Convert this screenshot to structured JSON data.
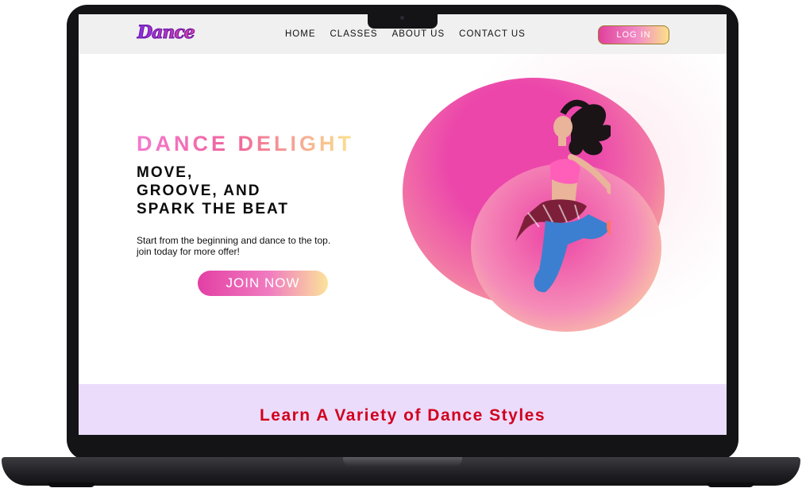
{
  "brand": {
    "logo_text": "Dance"
  },
  "nav": {
    "links": [
      {
        "label": "HOME"
      },
      {
        "label": "CLASSES"
      },
      {
        "label": "ABOUT US"
      },
      {
        "label": "CONTACT US"
      }
    ],
    "login_label": "LOG IN"
  },
  "hero": {
    "kicker": "DANCE DELIGHT",
    "headline_lines": [
      "MOVE,",
      "GROOVE, AND",
      "SPARK THE BEAT"
    ],
    "subtext_lines": [
      "Start from the beginning and dance to the top.",
      "join today for more offer!"
    ],
    "cta_label": "JOIN NOW"
  },
  "styles_section": {
    "title": "Learn A Variety of Dance Styles"
  },
  "colors": {
    "accent_pink": "#e33fa4",
    "accent_yellow": "#fbe39a",
    "section_bg": "#ebdcfb",
    "title_red": "#d1001e"
  },
  "icons": {
    "dancer_image": "jumping-dancer-image"
  }
}
